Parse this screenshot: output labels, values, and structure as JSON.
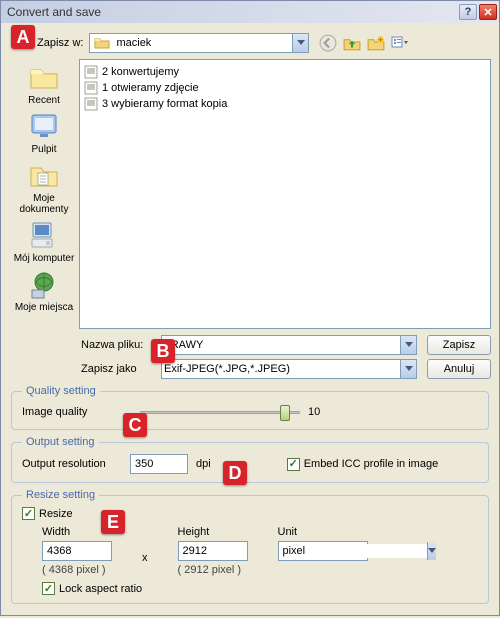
{
  "window": {
    "title": "Convert and save"
  },
  "annotations": {
    "a": "A",
    "b": "B",
    "c": "C",
    "d": "D",
    "e": "E"
  },
  "save_area": {
    "save_in_label": "Zapisz w:",
    "current_folder": "maciek",
    "filename_label": "Nazwa pliku:",
    "filename": "TRAWY",
    "save_as_label": "Zapisz jako",
    "save_as_type": "Exif-JPEG(*.JPG,*.JPEG)"
  },
  "buttons": {
    "save": "Zapisz",
    "cancel": "Anuluj"
  },
  "sidebar": [
    {
      "label": "Recent"
    },
    {
      "label": "Pulpit"
    },
    {
      "label": "Moje dokumenty"
    },
    {
      "label": "Mój komputer"
    },
    {
      "label": "Moje miejsca"
    }
  ],
  "files": [
    "2 konwertujemy",
    "1 otwieramy zdjęcie",
    "3 wybieramy format kopia"
  ],
  "quality": {
    "legend": "Quality setting",
    "label": "Image quality",
    "value": "10"
  },
  "output": {
    "legend": "Output setting",
    "resolution_label": "Output resolution",
    "resolution_value": "350",
    "dpi_label": "dpi",
    "embed_icc_label": "Embed ICC profile in image",
    "embed_icc_checked": true
  },
  "resize": {
    "legend": "Resize setting",
    "resize_label": "Resize",
    "resize_checked": true,
    "width_label": "Width",
    "width_value": "4368",
    "width_pixel_text": "( 4368 pixel )",
    "x_separator": "x",
    "height_label": "Height",
    "height_value": "2912",
    "height_pixel_text": "( 2912 pixel )",
    "unit_label": "Unit",
    "unit_value": "pixel",
    "lock_aspect_label": "Lock aspect ratio",
    "lock_aspect_checked": true
  }
}
